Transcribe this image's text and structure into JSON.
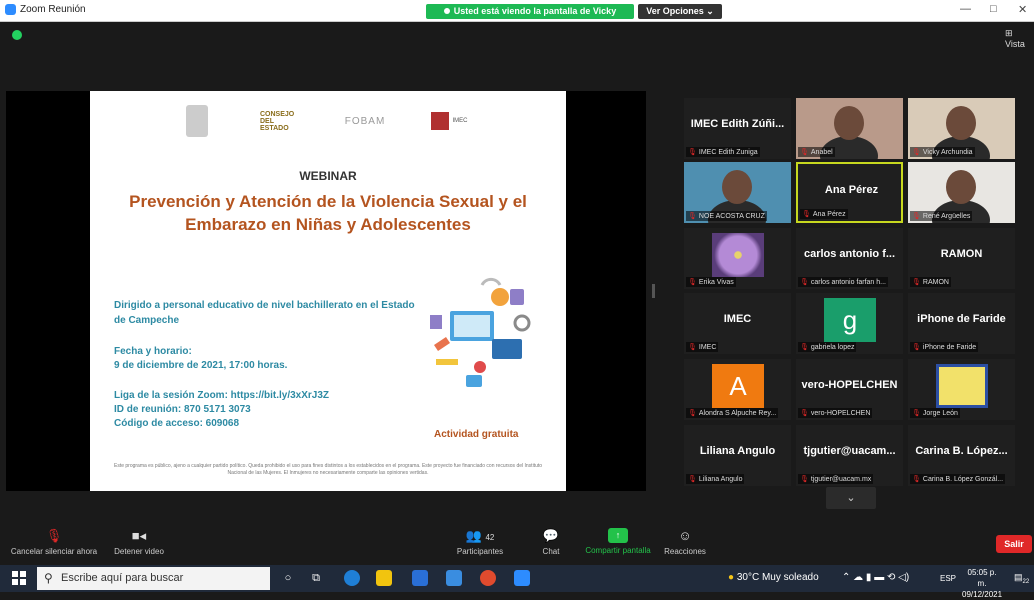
{
  "window": {
    "title": "Zoom Reunión",
    "view_options": "Ver Opciones ⌄",
    "minimize": "—",
    "maximize": "□",
    "close": "✕"
  },
  "banner": {
    "text": "Usted está viendo la pantalla de Vicky Archundia"
  },
  "top_right": {
    "view_label": "Vista"
  },
  "slide": {
    "logos": {
      "l2": "CONSEJO DEL ESTADO",
      "l3": "FOBAM",
      "l4": "IMEC"
    },
    "heading": "WEBINAR",
    "title_line1": "Prevención y Atención de la Violencia Sexual y el",
    "title_line2": "Embarazo en Niñas y Adolescentes",
    "audience": "Dirigido a personal educativo de nivel bachillerato en el Estado de Campeche",
    "schedule_label": "Fecha y horario:",
    "schedule": "9 de diciembre de 2021, 17:00 horas.",
    "link_line": "Liga de la sesión Zoom: https://bit.ly/3xXrJ3Z",
    "meeting_id": "ID de reunión: 870 5171 3073",
    "access_code": "Código de acceso: 609068",
    "free": "Actividad gratuita",
    "footer": "Este programa es público, ajeno a cualquier partido político. Queda prohibido el uso para fines distintos a los establecidos en el programa. Este proyecto fue financiado con recursos del Instituto Nacional de las Mujeres. El Inmujeres no necesariamente comparte las opiniones vertidas."
  },
  "participants": [
    {
      "name": "IMEC Edith Zúñi...",
      "label": "IMEC Edith Zuniga",
      "type": "name"
    },
    {
      "name": "",
      "label": "Anabel",
      "type": "video",
      "bg": "#b99a8a"
    },
    {
      "name": "",
      "label": "Vicky Archundia",
      "type": "video",
      "bg": "#d9cbb8"
    },
    {
      "name": "",
      "label": "NOE ACOSTA CRUZ",
      "type": "video",
      "bg": "#4f8fb0"
    },
    {
      "name": "Ana Pérez",
      "label": "Ana Pérez",
      "type": "name",
      "active": true
    },
    {
      "name": "",
      "label": "René Argüelles",
      "type": "video",
      "bg": "#e8e6e2"
    },
    {
      "name": "",
      "label": "Erika Vivas",
      "type": "flower"
    },
    {
      "name": "carlos antonio f...",
      "label": "carlos antonio farfan h...",
      "type": "name"
    },
    {
      "name": "RAMON",
      "label": "RAMON",
      "type": "name"
    },
    {
      "name": "IMEC",
      "label": "IMEC",
      "type": "name"
    },
    {
      "name": "",
      "label": "gabriela lopez",
      "type": "avatar",
      "letter": "g",
      "bg": "#1a9e6b"
    },
    {
      "name": "iPhone de Faride",
      "label": "iPhone de Faride",
      "type": "name"
    },
    {
      "name": "",
      "label": "Alondra S Alpuche Rey...",
      "type": "avatar",
      "letter": "A",
      "bg": "#f07a10"
    },
    {
      "name": "vero-HOPELCHEN",
      "label": "vero-HOPELCHEN",
      "type": "name"
    },
    {
      "name": "",
      "label": "Jorge León",
      "type": "crest"
    },
    {
      "name": "Liliana Angulo",
      "label": "Liliana Angulo",
      "type": "name"
    },
    {
      "name": "tjgutier@uacam...",
      "label": "tjgutier@uacam.mx",
      "type": "name"
    },
    {
      "name": "Carina B. López...",
      "label": "Carina B. López Gonzál...",
      "type": "name"
    }
  ],
  "toolbar": {
    "unmute": "Cancelar silenciar ahora",
    "stop_video": "Detener video",
    "participants": "Participantes",
    "participants_count": "42",
    "chat": "Chat",
    "share": "Compartir pantalla",
    "reactions": "Reacciones",
    "leave": "Salir"
  },
  "taskbar": {
    "search_placeholder": "Escribe aquí para buscar",
    "weather": "30°C  Muy soleado",
    "lang": "ESP",
    "time": "05:05 p. m.",
    "date": "09/12/2021",
    "notif": "22"
  },
  "colors": {
    "accent": "#2d8cff",
    "banner": "#1db954",
    "title": "#b4541f",
    "body": "#2d8aa3",
    "leave": "#e02828"
  }
}
